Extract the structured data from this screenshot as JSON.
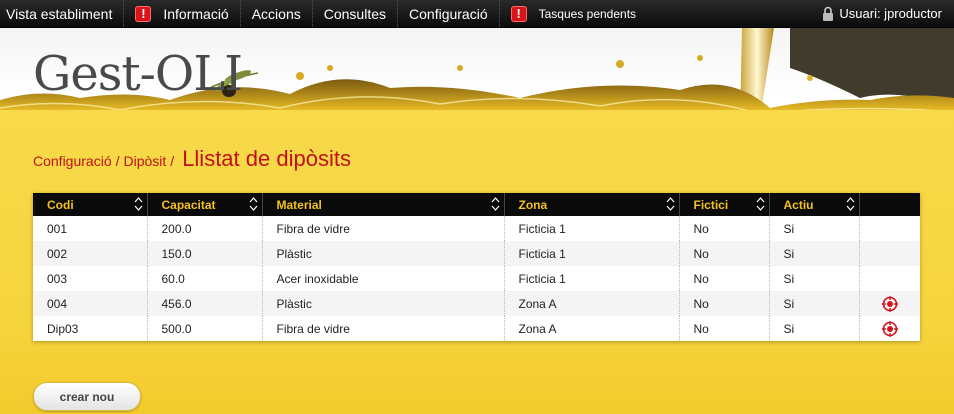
{
  "topbar": {
    "items": [
      {
        "label": "Vista establiment"
      },
      {
        "label": "Informació",
        "alert": "!"
      },
      {
        "label": "Accions"
      },
      {
        "label": "Consultes"
      },
      {
        "label": "Configuració"
      },
      {
        "label": "Tasques pendents",
        "alert": "!"
      }
    ],
    "user_label": "Usuari: jproductor"
  },
  "header": {
    "logo_text": "Gest-OLI"
  },
  "breadcrumb": {
    "items": [
      "Configuració",
      "Dipòsit"
    ],
    "separator": "/",
    "title": "Llistat de dipòsits"
  },
  "table": {
    "columns": [
      "Codi",
      "Capacitat",
      "Material",
      "Zona",
      "Fictici",
      "Actiu",
      ""
    ],
    "rows": [
      [
        "001",
        "200.0",
        "Fibra de vidre",
        "Ficticia 1",
        "No",
        "Si",
        ""
      ],
      [
        "002",
        "150.0",
        "Plàstic",
        "Ficticia 1",
        "No",
        "Si",
        ""
      ],
      [
        "003",
        "60.0",
        "Acer inoxidable",
        "Ficticia 1",
        "No",
        "Si",
        ""
      ],
      [
        "004",
        "456.0",
        "Plàstic",
        "Zona A",
        "No",
        "Si",
        "target-icon"
      ],
      [
        "Dip03",
        "500.0",
        "Fibra de vidre",
        "Zona A",
        "No",
        "Si",
        "target-icon"
      ]
    ]
  },
  "create_button": "crear nou",
  "colors": {
    "breadcrumb": "#c0111a",
    "header_text": "#f4c21a",
    "panel": "#f6d43c",
    "alert": "#d8141a"
  }
}
